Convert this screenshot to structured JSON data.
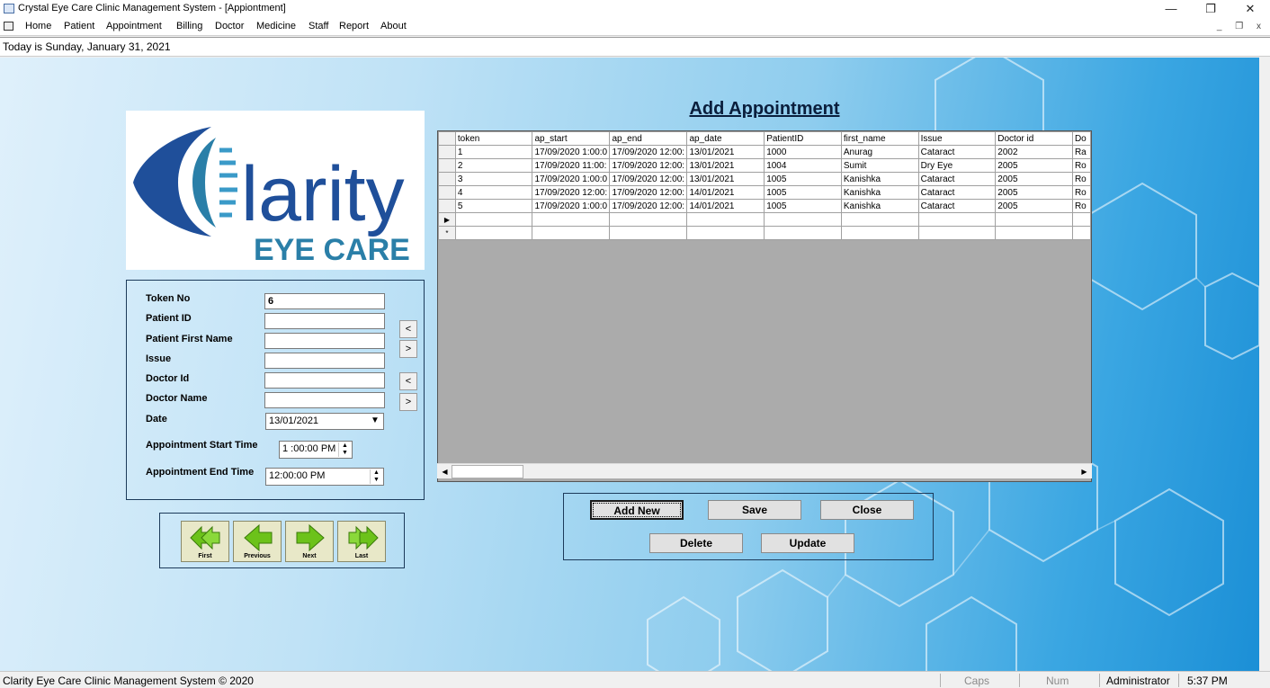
{
  "window": {
    "title": "Crystal Eye Care Clinic Management System - [Appiontment]",
    "minimize": "—",
    "restore": "❐",
    "close": "✕"
  },
  "menu": [
    "Home",
    "Patient",
    "Appointment",
    "Billing",
    "Doctor",
    "Medicine",
    "Staff",
    "Report",
    "About"
  ],
  "mdi_controls": "_ ❐ x",
  "today_text": "Today is Sunday, January 31, 2021",
  "logo": {
    "word": "larity",
    "sub": "EYE CARE"
  },
  "form": {
    "token_label": "Token No",
    "token_value": "6",
    "patient_id_label": "Patient ID",
    "patient_id_value": "",
    "patient_first_name_label": "Patient First Name",
    "patient_first_name_value": "",
    "issue_label": "Issue",
    "issue_value": "",
    "doctor_id_label": "Doctor Id",
    "doctor_id_value": "",
    "doctor_name_label": "Doctor Name",
    "doctor_name_value": "",
    "date_label": "Date",
    "date_value": "13/01/2021",
    "start_time_label": "Appointment Start Time",
    "start_time_value": "1 :00:00 PM",
    "end_time_label": "Appointment End Time",
    "end_time_value": "12:00:00 PM",
    "prev_symbol": "<",
    "next_symbol": ">"
  },
  "nav": {
    "first": "First",
    "previous": "Previous",
    "next": "Next",
    "last": "Last"
  },
  "heading": "Add Appointment",
  "grid": {
    "columns": [
      "token",
      "ap_start",
      "ap_end",
      "ap_date",
      "PatientID",
      "first_name",
      "Issue",
      "Doctor id",
      "Do"
    ],
    "rows": [
      [
        "1",
        "17/09/2020 1:00:0",
        "17/09/2020 12:00:",
        "13/01/2021",
        "1000",
        "Anurag",
        "Cataract",
        "2002",
        "Ra"
      ],
      [
        "2",
        "17/09/2020 11:00:",
        "17/09/2020 12:00:",
        "13/01/2021",
        "1004",
        "Sumit",
        "Dry Eye",
        "2005",
        "Ro"
      ],
      [
        "3",
        "17/09/2020 1:00:0",
        "17/09/2020 12:00:",
        "13/01/2021",
        "1005",
        "Kanishka",
        "Cataract",
        "2005",
        "Ro"
      ],
      [
        "4",
        "17/09/2020 12:00:",
        "17/09/2020 12:00:",
        "14/01/2021",
        "1005",
        "Kanishka",
        "Cataract",
        "2005",
        "Ro"
      ],
      [
        "5",
        "17/09/2020 1:00:0",
        "17/09/2020 12:00:",
        "14/01/2021",
        "1005",
        "Kanishka",
        "Cataract",
        "2005",
        "Ro"
      ]
    ],
    "current_row_marker": "▶",
    "new_row_marker": "*"
  },
  "actions": {
    "add_new": "Add New",
    "save": "Save",
    "close": "Close",
    "delete": "Delete",
    "update": "Update"
  },
  "status": {
    "left": "Clarity Eye Care Clinic Management System © 2020",
    "caps": "Caps",
    "num": "Num",
    "user": "Administrator",
    "time": "5:37 PM"
  },
  "colors": {
    "accent_blue": "#1f4f9a",
    "logo_teal": "#2a7fa8",
    "nav_arrow_green": "#6cc21a"
  }
}
